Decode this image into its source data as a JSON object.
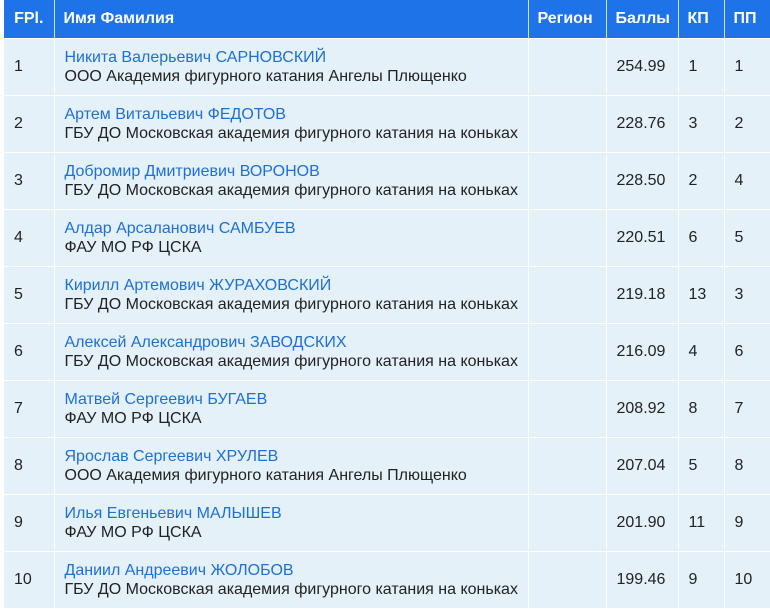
{
  "table": {
    "headers": {
      "fpl": "FPl.",
      "name": "Имя Фамилия",
      "region": "Регион",
      "points": "Баллы",
      "sp": "КП",
      "fs": "ПП"
    },
    "rows": [
      {
        "fpl": "1",
        "name": "Никита Валерьевич САРНОВСКИЙ",
        "club": "ООО Академия фигурного катания Ангелы Плющенко",
        "region": "",
        "points": "254.99",
        "sp": "1",
        "fs": "1"
      },
      {
        "fpl": "2",
        "name": "Артем Витальевич ФЕДОТОВ",
        "club": "ГБУ ДО Московская академия фигурного катания на коньках",
        "region": "",
        "points": "228.76",
        "sp": "3",
        "fs": "2"
      },
      {
        "fpl": "3",
        "name": "Добромир Дмитриевич ВОРОНОВ",
        "club": "ГБУ ДО Московская академия фигурного катания на коньках",
        "region": "",
        "points": "228.50",
        "sp": "2",
        "fs": "4"
      },
      {
        "fpl": "4",
        "name": "Алдар Арсаланович САМБУЕВ",
        "club": "ФАУ МО РФ ЦСКА",
        "region": "",
        "points": "220.51",
        "sp": "6",
        "fs": "5"
      },
      {
        "fpl": "5",
        "name": "Кирилл Артемович ЖУРАХОВСКИЙ",
        "club": "ГБУ ДО Московская академия фигурного катания на коньках",
        "region": "",
        "points": "219.18",
        "sp": "13",
        "fs": "3"
      },
      {
        "fpl": "6",
        "name": "Алексей Александрович ЗАВОДСКИХ",
        "club": "ГБУ ДО Московская академия фигурного катания на коньках",
        "region": "",
        "points": "216.09",
        "sp": "4",
        "fs": "6"
      },
      {
        "fpl": "7",
        "name": "Матвей Сергеевич БУГАЕВ",
        "club": "ФАУ МО РФ ЦСКА",
        "region": "",
        "points": "208.92",
        "sp": "8",
        "fs": "7"
      },
      {
        "fpl": "8",
        "name": "Ярослав Сергеевич ХРУЛЕВ",
        "club": "ООО Академия фигурного катания Ангелы Плющенко",
        "region": "",
        "points": "207.04",
        "sp": "5",
        "fs": "8"
      },
      {
        "fpl": "9",
        "name": "Илья Евгеньевич МАЛЫШЕВ",
        "club": "ФАУ МО РФ ЦСКА",
        "region": "",
        "points": "201.90",
        "sp": "11",
        "fs": "9"
      },
      {
        "fpl": "10",
        "name": "Даниил Андреевич ЖОЛОБОВ",
        "club": "ГБУ ДО Московская академия фигурного катания на коньках",
        "region": "",
        "points": "199.46",
        "sp": "9",
        "fs": "10"
      }
    ]
  },
  "colors": {
    "header_bg": "#1e73e8",
    "row_bg": "#e4f1f8",
    "link": "#1f6fd6"
  }
}
